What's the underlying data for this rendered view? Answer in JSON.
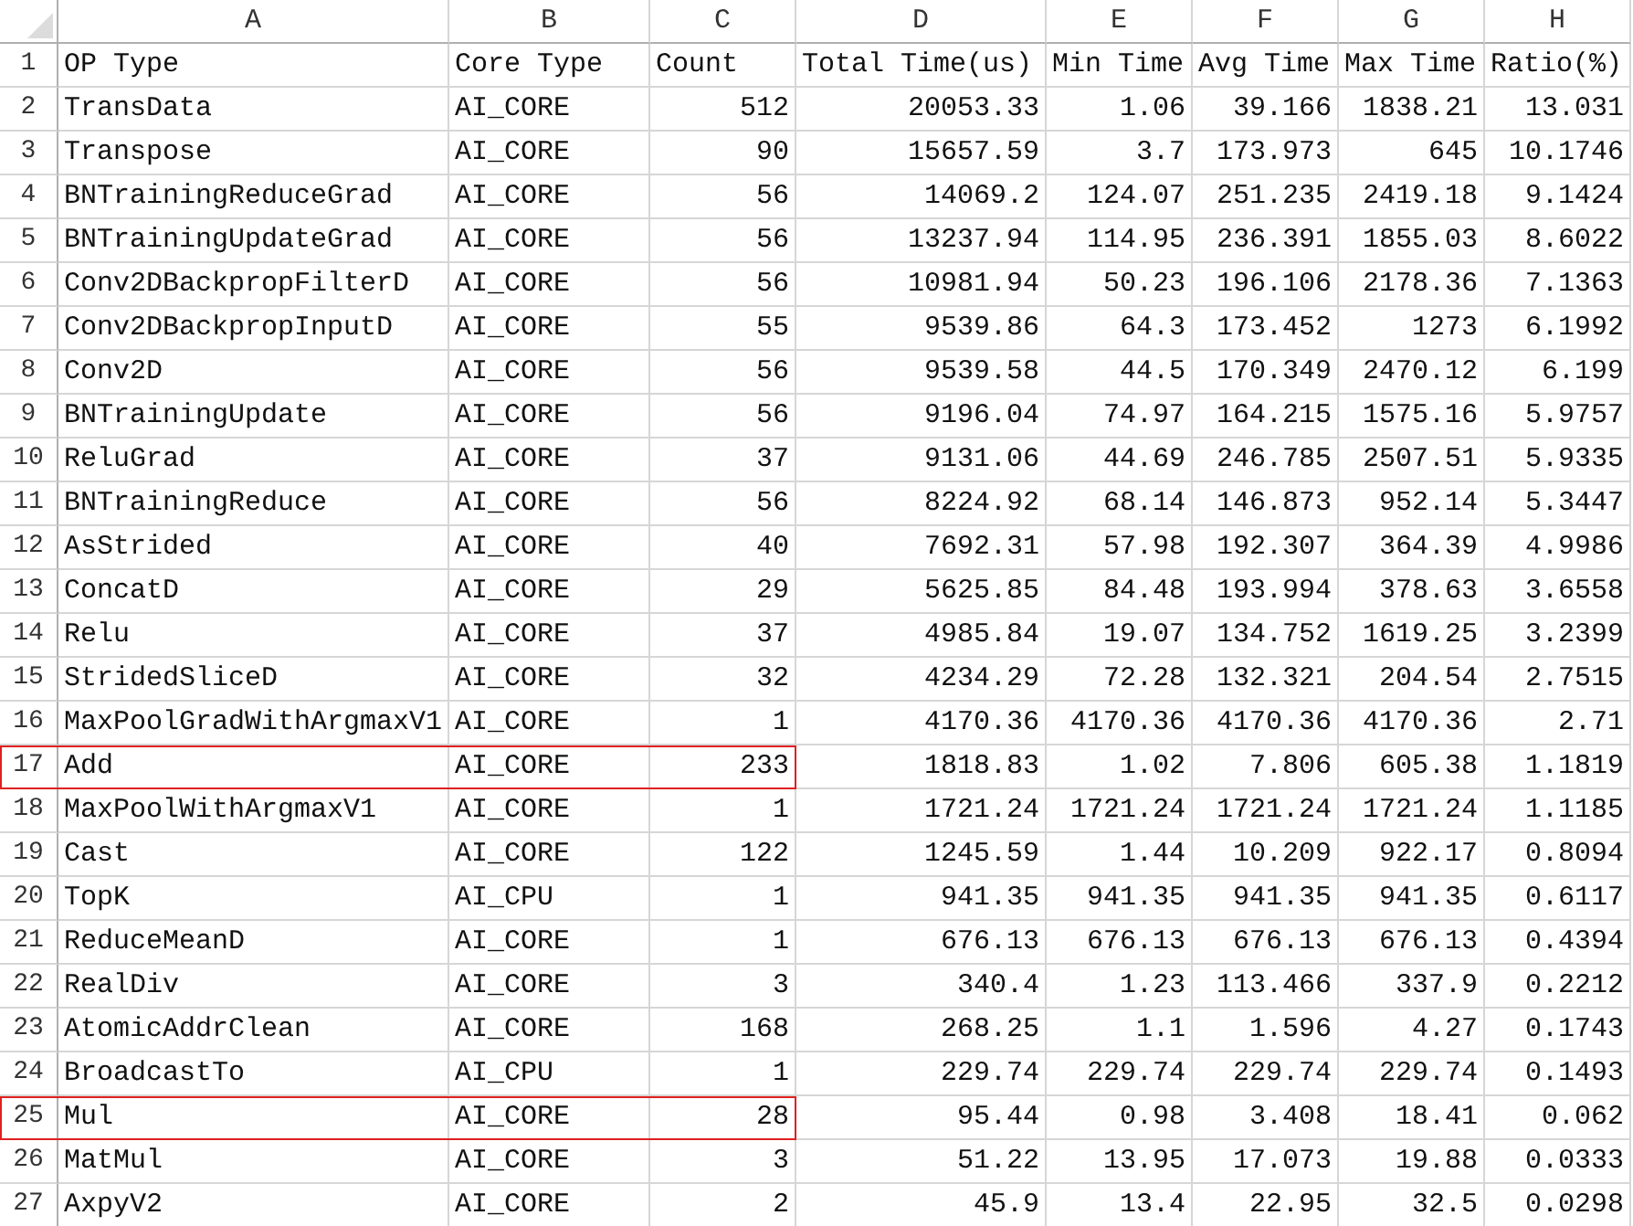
{
  "column_headers": [
    "A",
    "B",
    "C",
    "D",
    "E",
    "F",
    "G",
    "H"
  ],
  "rows": [
    {
      "number": "1",
      "highlighted": false,
      "cells": [
        "OP Type",
        "Core Type",
        "Count",
        "Total Time(us)",
        "Min Time",
        "Avg Time",
        "Max Time",
        "Ratio(%)"
      ]
    },
    {
      "number": "2",
      "highlighted": false,
      "cells": [
        "TransData",
        "AI_CORE",
        "512",
        "20053.33",
        "1.06",
        "39.166",
        "1838.21",
        "13.031"
      ]
    },
    {
      "number": "3",
      "highlighted": false,
      "cells": [
        "Transpose",
        "AI_CORE",
        "90",
        "15657.59",
        "3.7",
        "173.973",
        "645",
        "10.1746"
      ]
    },
    {
      "number": "4",
      "highlighted": false,
      "cells": [
        "BNTrainingReduceGrad",
        "AI_CORE",
        "56",
        "14069.2",
        "124.07",
        "251.235",
        "2419.18",
        "9.1424"
      ]
    },
    {
      "number": "5",
      "highlighted": false,
      "cells": [
        "BNTrainingUpdateGrad",
        "AI_CORE",
        "56",
        "13237.94",
        "114.95",
        "236.391",
        "1855.03",
        "8.6022"
      ]
    },
    {
      "number": "6",
      "highlighted": false,
      "cells": [
        "Conv2DBackpropFilterD",
        "AI_CORE",
        "56",
        "10981.94",
        "50.23",
        "196.106",
        "2178.36",
        "7.1363"
      ]
    },
    {
      "number": "7",
      "highlighted": false,
      "cells": [
        "Conv2DBackpropInputD",
        "AI_CORE",
        "55",
        "9539.86",
        "64.3",
        "173.452",
        "1273",
        "6.1992"
      ]
    },
    {
      "number": "8",
      "highlighted": false,
      "cells": [
        "Conv2D",
        "AI_CORE",
        "56",
        "9539.58",
        "44.5",
        "170.349",
        "2470.12",
        "6.199"
      ]
    },
    {
      "number": "9",
      "highlighted": false,
      "cells": [
        "BNTrainingUpdate",
        "AI_CORE",
        "56",
        "9196.04",
        "74.97",
        "164.215",
        "1575.16",
        "5.9757"
      ]
    },
    {
      "number": "10",
      "highlighted": false,
      "cells": [
        "ReluGrad",
        "AI_CORE",
        "37",
        "9131.06",
        "44.69",
        "246.785",
        "2507.51",
        "5.9335"
      ]
    },
    {
      "number": "11",
      "highlighted": false,
      "cells": [
        "BNTrainingReduce",
        "AI_CORE",
        "56",
        "8224.92",
        "68.14",
        "146.873",
        "952.14",
        "5.3447"
      ]
    },
    {
      "number": "12",
      "highlighted": false,
      "cells": [
        "AsStrided",
        "AI_CORE",
        "40",
        "7692.31",
        "57.98",
        "192.307",
        "364.39",
        "4.9986"
      ]
    },
    {
      "number": "13",
      "highlighted": false,
      "cells": [
        "ConcatD",
        "AI_CORE",
        "29",
        "5625.85",
        "84.48",
        "193.994",
        "378.63",
        "3.6558"
      ]
    },
    {
      "number": "14",
      "highlighted": false,
      "cells": [
        "Relu",
        "AI_CORE",
        "37",
        "4985.84",
        "19.07",
        "134.752",
        "1619.25",
        "3.2399"
      ]
    },
    {
      "number": "15",
      "highlighted": false,
      "cells": [
        "StridedSliceD",
        "AI_CORE",
        "32",
        "4234.29",
        "72.28",
        "132.321",
        "204.54",
        "2.7515"
      ]
    },
    {
      "number": "16",
      "highlighted": false,
      "cells": [
        "MaxPoolGradWithArgmaxV1",
        "AI_CORE",
        "1",
        "4170.36",
        "4170.36",
        "4170.36",
        "4170.36",
        "2.71"
      ]
    },
    {
      "number": "17",
      "highlighted": true,
      "cells": [
        "Add",
        "AI_CORE",
        "233",
        "1818.83",
        "1.02",
        "7.806",
        "605.38",
        "1.1819"
      ]
    },
    {
      "number": "18",
      "highlighted": false,
      "cells": [
        "MaxPoolWithArgmaxV1",
        "AI_CORE",
        "1",
        "1721.24",
        "1721.24",
        "1721.24",
        "1721.24",
        "1.1185"
      ]
    },
    {
      "number": "19",
      "highlighted": false,
      "cells": [
        "Cast",
        "AI_CORE",
        "122",
        "1245.59",
        "1.44",
        "10.209",
        "922.17",
        "0.8094"
      ]
    },
    {
      "number": "20",
      "highlighted": false,
      "cells": [
        "TopK",
        "AI_CPU",
        "1",
        "941.35",
        "941.35",
        "941.35",
        "941.35",
        "0.6117"
      ]
    },
    {
      "number": "21",
      "highlighted": false,
      "cells": [
        "ReduceMeanD",
        "AI_CORE",
        "1",
        "676.13",
        "676.13",
        "676.13",
        "676.13",
        "0.4394"
      ]
    },
    {
      "number": "22",
      "highlighted": false,
      "cells": [
        "RealDiv",
        "AI_CORE",
        "3",
        "340.4",
        "1.23",
        "113.466",
        "337.9",
        "0.2212"
      ]
    },
    {
      "number": "23",
      "highlighted": false,
      "cells": [
        "AtomicAddrClean",
        "AI_CORE",
        "168",
        "268.25",
        "1.1",
        "1.596",
        "4.27",
        "0.1743"
      ]
    },
    {
      "number": "24",
      "highlighted": false,
      "cells": [
        "BroadcastTo",
        "AI_CPU",
        "1",
        "229.74",
        "229.74",
        "229.74",
        "229.74",
        "0.1493"
      ]
    },
    {
      "number": "25",
      "highlighted": true,
      "cells": [
        "Mul",
        "AI_CORE",
        "28",
        "95.44",
        "0.98",
        "3.408",
        "18.41",
        "0.062"
      ]
    },
    {
      "number": "26",
      "highlighted": false,
      "cells": [
        "MatMul",
        "AI_CORE",
        "3",
        "51.22",
        "13.95",
        "17.073",
        "19.88",
        "0.0333"
      ]
    },
    {
      "number": "27",
      "highlighted": false,
      "cells": [
        "AxpyV2",
        "AI_CORE",
        "2",
        "45.9",
        "13.4",
        "22.95",
        "32.5",
        "0.0298"
      ]
    }
  ]
}
